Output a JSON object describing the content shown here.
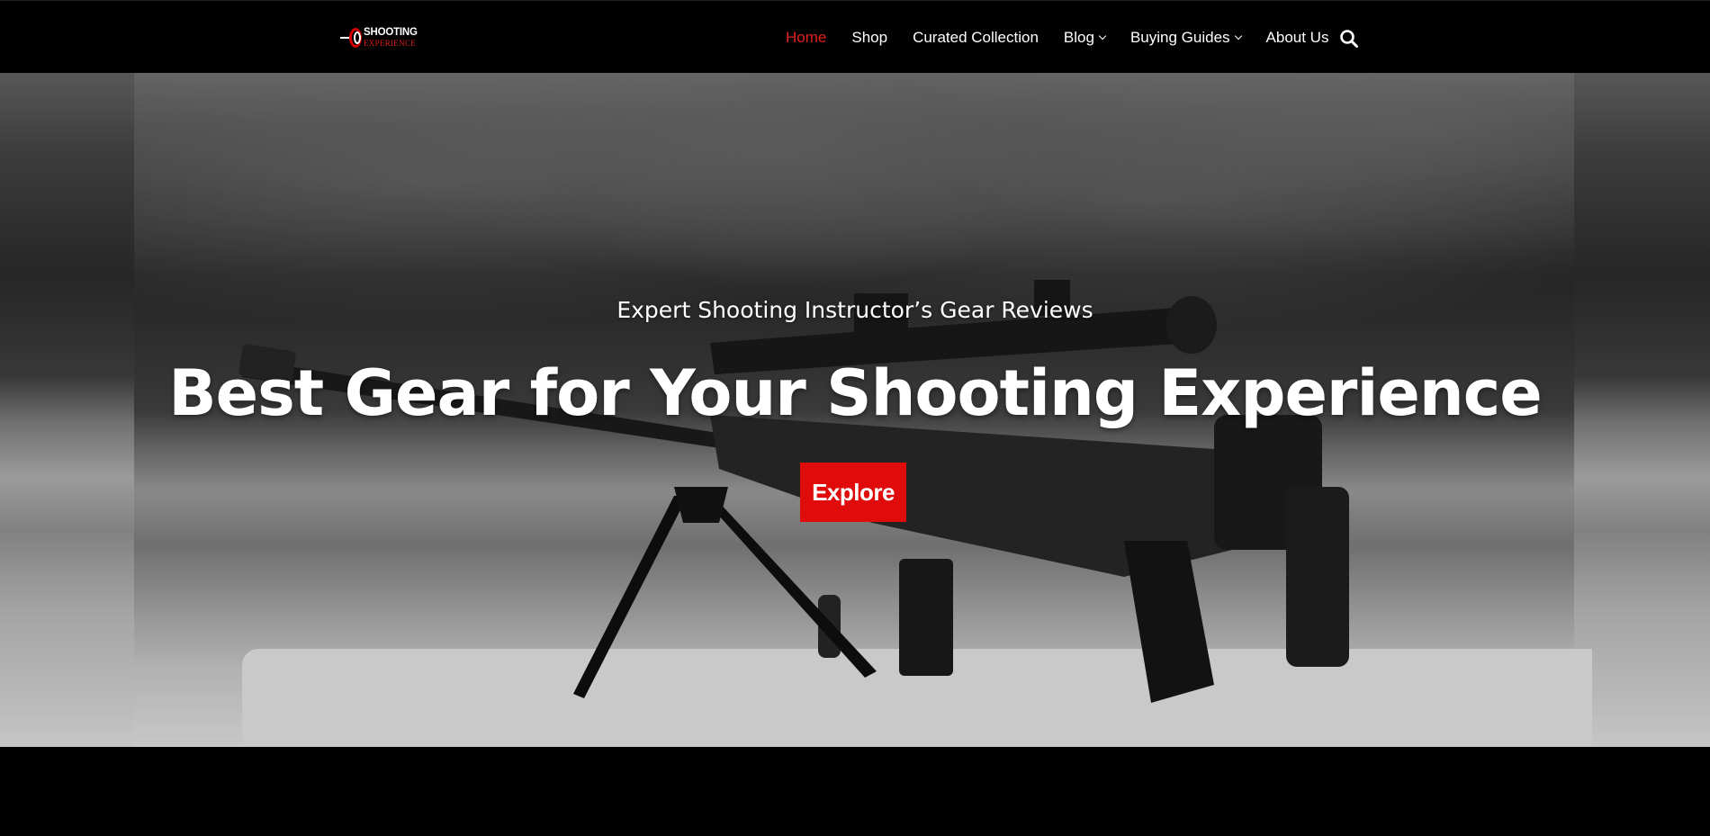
{
  "logo": {
    "line1": "SHOOTING",
    "line2": "EXPERIENCE"
  },
  "nav": {
    "items": [
      {
        "label": "Home",
        "active": true
      },
      {
        "label": "Shop"
      },
      {
        "label": "Curated Collection"
      },
      {
        "label": "Blog",
        "dropdown": true
      },
      {
        "label": "Buying Guides",
        "dropdown": true
      },
      {
        "label": "About Us"
      }
    ],
    "search_icon": "search-icon"
  },
  "hero": {
    "subtitle": "Expert Shooting Instructor’s Gear Reviews",
    "title": "Best Gear for Your Shooting Experience",
    "button": "Explore"
  },
  "colors": {
    "accent": "#e00c0c",
    "active_nav": "#e11f1f",
    "header_bg": "#000000"
  }
}
